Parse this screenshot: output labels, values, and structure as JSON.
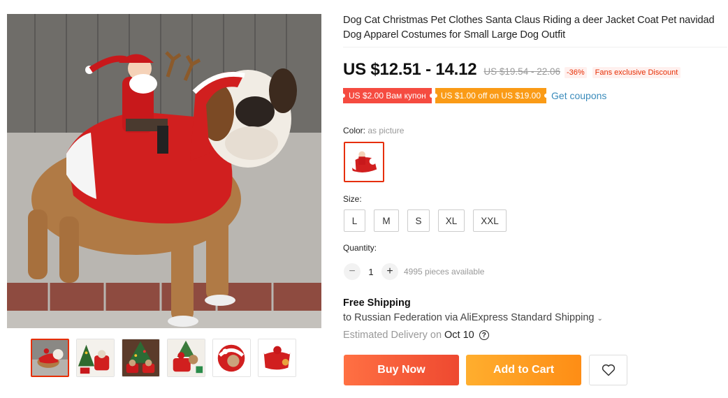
{
  "product": {
    "title": "Dog Cat Christmas Pet Clothes Santa Claus Riding a deer Jacket Coat Pet navidad Dog Apparel Costumes for Small Large Dog Outfit",
    "main_image_icon": "dog-santa-costume-photo"
  },
  "gallery": {
    "thumbnails": [
      {
        "icon": "dog-santa-costume-photo",
        "selected": true
      },
      {
        "icon": "dogs-christmas-tree-photo"
      },
      {
        "icon": "dogs-christmas-costumes-photo"
      },
      {
        "icon": "dog-santa-rider-photo"
      },
      {
        "icon": "costume-product-photo"
      },
      {
        "icon": "costume-flat-photo"
      }
    ]
  },
  "price": {
    "current": "US $12.51 - 14.12",
    "original": "US $19.54 - 22.06",
    "discount": "-36%",
    "promo": "Fans exclusive Discount"
  },
  "coupons": {
    "items": [
      "US $2.00 Вам купон",
      "US $1.00 off on US $19.00"
    ],
    "link": "Get coupons"
  },
  "color": {
    "label": "Color:",
    "value": "as picture"
  },
  "size": {
    "label": "Size:",
    "options": [
      "L",
      "M",
      "S",
      "XL",
      "XXL"
    ]
  },
  "quantity": {
    "label": "Quantity:",
    "value": "1",
    "minus": "−",
    "plus": "+",
    "available": "4995 pieces available"
  },
  "shipping": {
    "title": "Free Shipping",
    "to": "to Russian Federation via AliExpress Standard Shipping",
    "chevron": "⌄",
    "estimated": "Estimated Delivery on",
    "date": "Oct 10",
    "help": "?"
  },
  "actions": {
    "buy_now": "Buy Now",
    "add_to_cart": "Add to Cart",
    "wishlist_icon": "heart-icon"
  },
  "colors": {
    "accent_red": "#e62e04",
    "buy_now": "#f0512f",
    "add_to_cart": "#fe9a1e",
    "coupon_red": "#f54b40",
    "coupon_orange": "#fa9b16",
    "link_blue": "#3a8bbb"
  }
}
